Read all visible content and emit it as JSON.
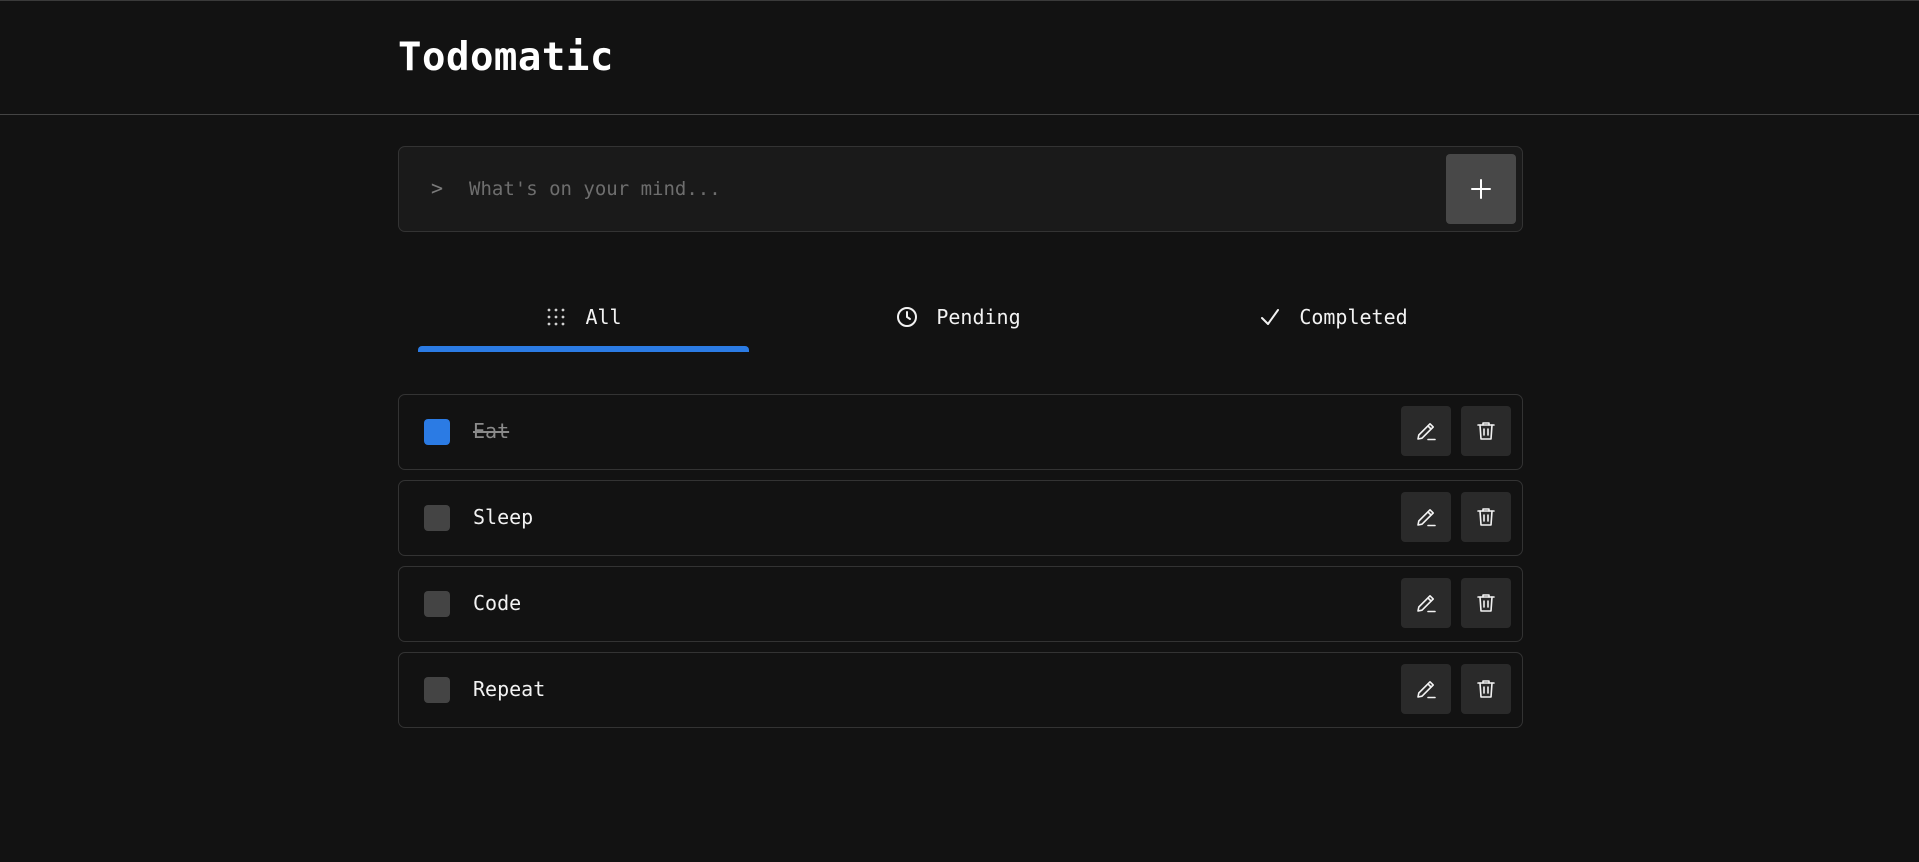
{
  "app": {
    "title": "Todomatic"
  },
  "add_form": {
    "prompt_glyph": ">",
    "placeholder": "What's on your mind...",
    "value": "",
    "add_icon": "plus-icon"
  },
  "tabs": [
    {
      "label": "All",
      "icon": "grid-dots-icon",
      "active": true
    },
    {
      "label": "Pending",
      "icon": "clock-icon",
      "active": false
    },
    {
      "label": "Completed",
      "icon": "checkmark-icon",
      "active": false
    }
  ],
  "todos": [
    {
      "text": "Eat",
      "completed": true
    },
    {
      "text": "Sleep",
      "completed": false
    },
    {
      "text": "Code",
      "completed": false
    },
    {
      "text": "Repeat",
      "completed": false
    }
  ],
  "item_actions": {
    "edit_icon": "pencil-icon",
    "delete_icon": "trash-icon"
  },
  "colors": {
    "background": "#121212",
    "accent": "#2b7be4",
    "unchecked": "#444444",
    "action_button": "#2a2a2a",
    "add_button": "#484848"
  }
}
